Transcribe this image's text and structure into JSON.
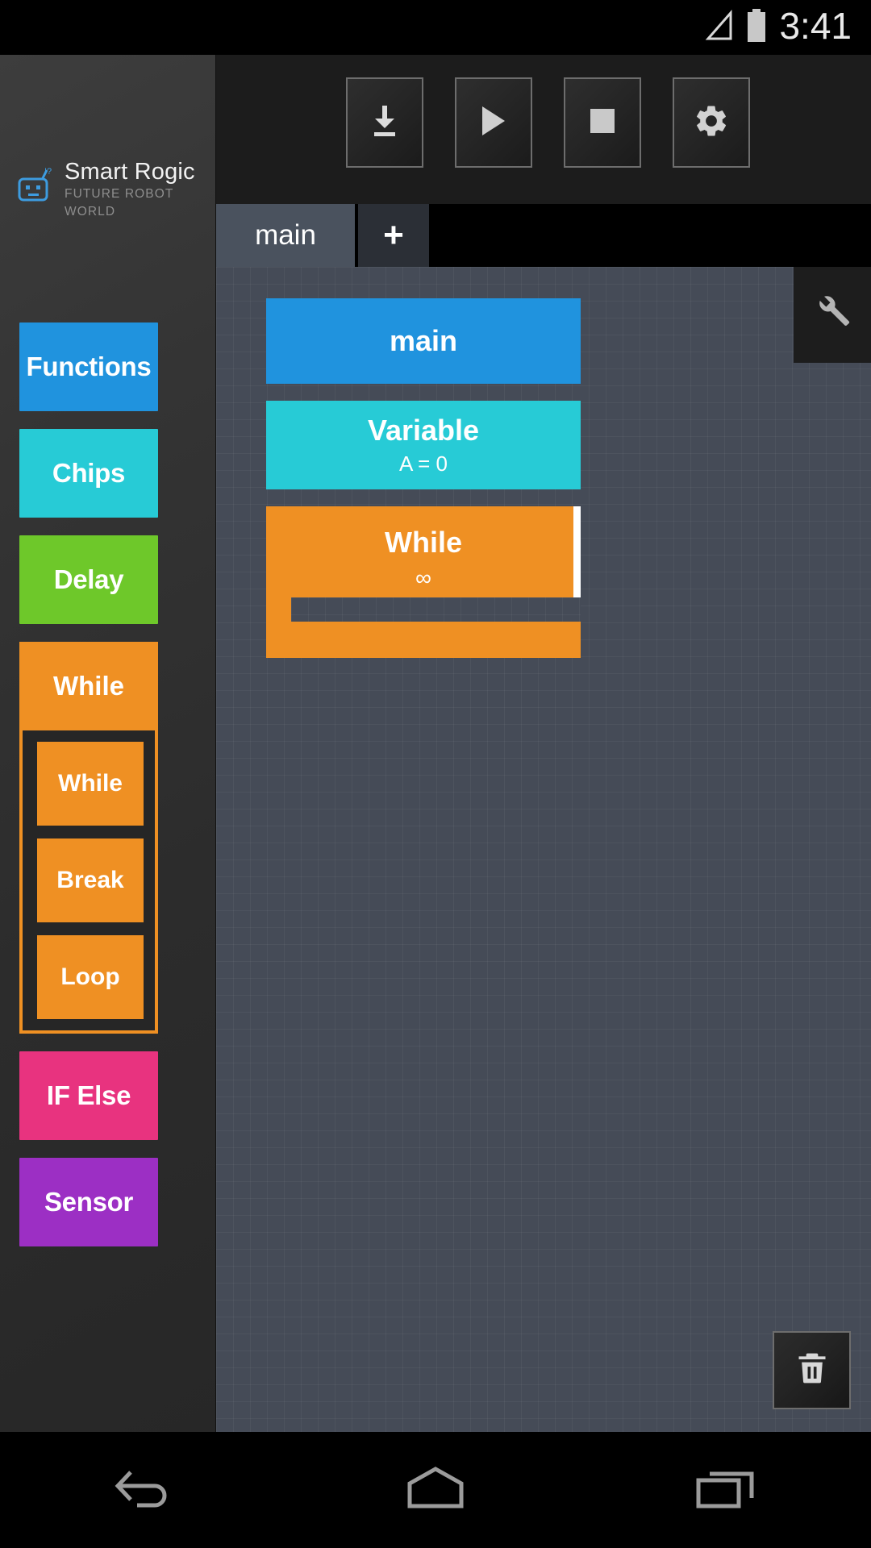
{
  "status_bar": {
    "time": "3:41",
    "signal_icon": "signal-triangle-icon",
    "battery_icon": "battery-full-icon"
  },
  "sidebar": {
    "logo": {
      "brand": "Smart Rogic",
      "tagline": "FUTURE ROBOT WORLD",
      "icon": "robot-head-icon",
      "accent_color": "#3d9ce0"
    },
    "palette": [
      {
        "label": "Functions",
        "color": "#2093de",
        "name": "palette-functions"
      },
      {
        "label": "Chips",
        "color": "#27cbd6",
        "name": "palette-chips"
      },
      {
        "label": "Delay",
        "color": "#6ec82a",
        "name": "palette-delay"
      }
    ],
    "while_group": {
      "header": "While",
      "color": "#ef9023",
      "items": [
        {
          "label": "While"
        },
        {
          "label": "Break"
        },
        {
          "label": "Loop"
        }
      ]
    },
    "palette_after": [
      {
        "label": "IF Else",
        "color": "#e8337f",
        "name": "palette-if-else"
      },
      {
        "label": "Sensor",
        "color": "#9c2fc4",
        "name": "palette-sensor"
      }
    ]
  },
  "toolbar": {
    "buttons": [
      {
        "label": "Download",
        "icon": "download-icon"
      },
      {
        "label": "Run",
        "icon": "play-icon"
      },
      {
        "label": "Stop",
        "icon": "stop-icon"
      },
      {
        "label": "Settings",
        "icon": "gear-icon"
      }
    ]
  },
  "tabs": {
    "items": [
      {
        "label": "main",
        "active": true
      }
    ],
    "add_label": "+"
  },
  "canvas": {
    "grid": true,
    "background_color": "#454b57",
    "blocks": [
      {
        "type": "main",
        "title": "main",
        "subtitle": "",
        "color": "#2093de"
      },
      {
        "type": "variable",
        "title": "Variable",
        "subtitle": "A = 0",
        "color": "#27cbd6"
      },
      {
        "type": "while",
        "title": "While",
        "subtitle": "∞",
        "color": "#ef9023",
        "selected": true
      }
    ],
    "tool_panel_icon": "wrench-icon",
    "trash_icon": "trash-icon"
  },
  "navbar": {
    "back": "back-icon",
    "home": "home-icon",
    "recents": "recents-icon"
  }
}
